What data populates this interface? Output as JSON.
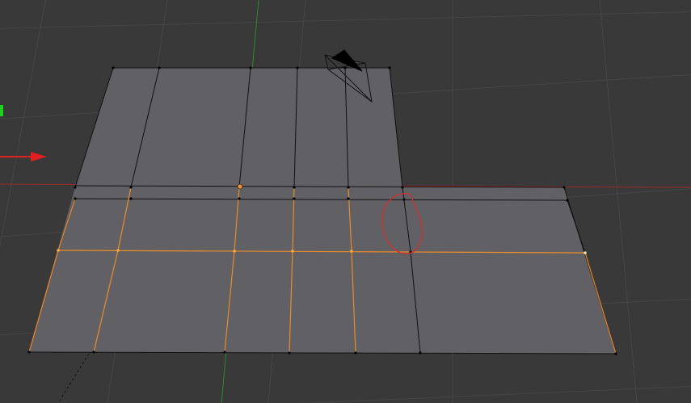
{
  "viewport": {
    "mode": "edit-mode",
    "view": "perspective"
  },
  "colors": {
    "background": "#393939",
    "grid": "#4a4a4a",
    "face": "#616065",
    "edge": "#000000",
    "selected_edge": "#ff9b32",
    "active_vertex": "#ffb45a",
    "x_axis": "#a02828",
    "y_axis": "#2e8b2e",
    "annotation_circle": "#e03a3a",
    "manipulator_x": "#e02020",
    "manipulator_y": "#20d020"
  },
  "icons": {
    "camera": "camera-icon",
    "transform_manipulator": "manipulator-icon",
    "annotation": "red-circle-annotation"
  }
}
